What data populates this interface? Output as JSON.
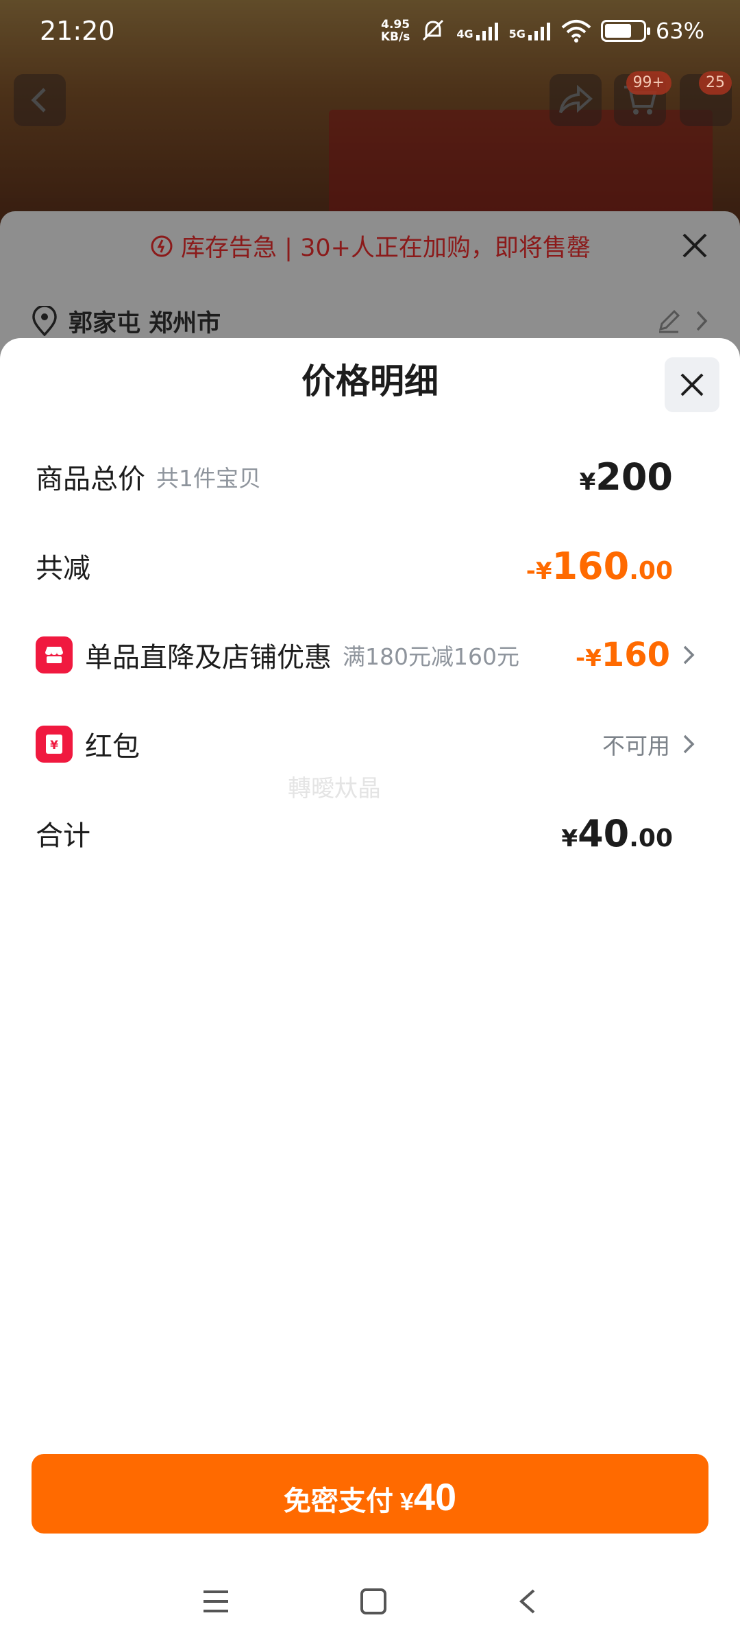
{
  "status_bar": {
    "time": "21:20",
    "net_speed_value": "4.95",
    "net_speed_unit": "KB/s",
    "signal_1": "4G",
    "signal_2": "5G",
    "battery": "63%"
  },
  "background": {
    "cart_badge": "99+",
    "message_badge": "25",
    "stock_alert": "库存告急 | 30+人正在加购，即将售罄",
    "address": "郭家屯 郑州市"
  },
  "sheet": {
    "title": "价格明细",
    "rows": {
      "total": {
        "label": "商品总价",
        "sub": "共1件宝贝",
        "currency": "¥",
        "amount": "200"
      },
      "discount": {
        "label": "共减",
        "prefix": "-",
        "currency": "¥",
        "amount": "160",
        "decimal": ".00"
      },
      "store_offer": {
        "label": "单品直降及店铺优惠",
        "sub": "满180元减160元",
        "prefix": "-",
        "currency": "¥",
        "amount": "160"
      },
      "red_packet": {
        "label": "红包",
        "status": "不可用"
      },
      "sum": {
        "label": "合计",
        "currency": "¥",
        "amount": "40",
        "decimal": ".00"
      }
    },
    "watermark": "轉曖夶晶"
  },
  "pay_button": {
    "label": "免密支付",
    "currency": "¥",
    "amount": "40"
  },
  "colors": {
    "accent": "#ff6a00",
    "badge_red": "#f0193f",
    "alert_red": "#8b1a1a"
  },
  "icons": [
    "back-icon",
    "share-icon",
    "cart-icon",
    "alarm-icon",
    "close-icon",
    "location-icon",
    "edit-icon",
    "chevron-right-icon",
    "store-icon",
    "red-packet-icon",
    "menu-icon",
    "home-icon",
    "nav-back-icon"
  ]
}
